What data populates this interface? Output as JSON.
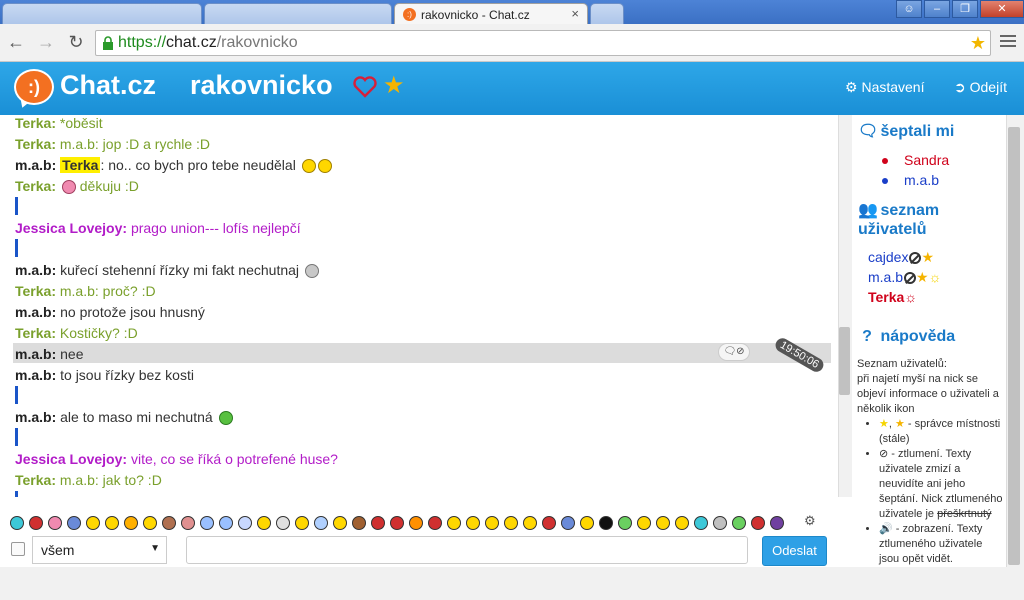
{
  "browser": {
    "tabs": [
      {
        "title": ""
      },
      {
        "title": ""
      },
      {
        "title": "rakovnicko - Chat.cz",
        "close": "×"
      }
    ],
    "url": {
      "scheme": "https://",
      "host": "chat.cz",
      "path": "/rakovnicko"
    }
  },
  "header": {
    "logo_glyph": ":)",
    "site_name": "Chat.cz",
    "room_name": "rakovnicko",
    "settings_label": "Nastavení",
    "logout_label": "Odejít",
    "colors": {
      "header_bg": "#1a8fd6",
      "logo": "#f37021",
      "fav_star": "#f5b400",
      "fav_heart": "#e03030"
    }
  },
  "messages": [
    {
      "nick": "Terka:",
      "text": " *oběsit",
      "style": "green"
    },
    {
      "nick": "Terka:",
      "text": " m.a.b: jop :D a rychle :D",
      "style": "green"
    },
    {
      "nick": "m.a.b:",
      "highlight": "Terka",
      "text": ": no.. co bych pro tebe neudělal",
      "style": "black"
    },
    {
      "nick": "Terka:",
      "text": " děkuju :D",
      "style": "green"
    },
    {
      "nick": "Jessica Lovejoy:",
      "text": " prago union--- lofís nejlepčí",
      "style": "purple"
    },
    {
      "nick": "m.a.b:",
      "text": " kuřecí stehenní řízky mi fakt nechutnaj",
      "style": "black"
    },
    {
      "nick": "Terka:",
      "text": " m.a.b: proč? :D",
      "style": "green"
    },
    {
      "nick": "m.a.b:",
      "text": " no protože jsou hnusný",
      "style": "black"
    },
    {
      "nick": "Terka:",
      "text": " Kostičky? :D",
      "style": "green"
    },
    {
      "nick": "m.a.b:",
      "text": " nee",
      "style": "black"
    },
    {
      "nick": "m.a.b:",
      "text": " to jsou řízky bez kosti",
      "style": "black"
    },
    {
      "nick": "m.a.b:",
      "text": " ale to maso mi nechutná",
      "style": "black"
    },
    {
      "nick": "Jessica Lovejoy:",
      "text": " vite, co se říká o potrefené huse?",
      "style": "purple"
    },
    {
      "nick": "Terka:",
      "text": " m.a.b: jak to? :D",
      "style": "green"
    }
  ],
  "hover": {
    "timestamp": "19:50:06"
  },
  "sidebar": {
    "whisper_title": "šeptali mi",
    "whisper_users": [
      {
        "name": "Sandra",
        "color": "#d0021b"
      },
      {
        "name": "m.a.b",
        "color": "#1a3ec8"
      }
    ],
    "users_title": "seznam uživatelů",
    "users": [
      {
        "name": "cajdex",
        "color": "#1a3ec8"
      },
      {
        "name": "m.a.b",
        "color": "#1a3ec8"
      },
      {
        "name": "Terka",
        "color": "#d0021b"
      }
    ],
    "help_title": "nápověda",
    "help_intro": "Seznam uživatelů:",
    "help_desc": "při najetí myší na nick se objeví informace o uživateli a několik ikon",
    "help_items": [
      {
        "text": " - správce místnosti (stále)"
      },
      {
        "text": " - ztlumení. Texty uživatele zmizí a neuvidíte ani jeho šeptání. Nick ztlumeného uživatele je",
        "strike": "přeškrtnutý"
      },
      {
        "text": " - zobrazení. Texty ztlumeného uživatele jsou opět vidět."
      }
    ]
  },
  "composer": {
    "recipient": "všem",
    "send_label": "Odeslat",
    "message_placeholder": ""
  }
}
